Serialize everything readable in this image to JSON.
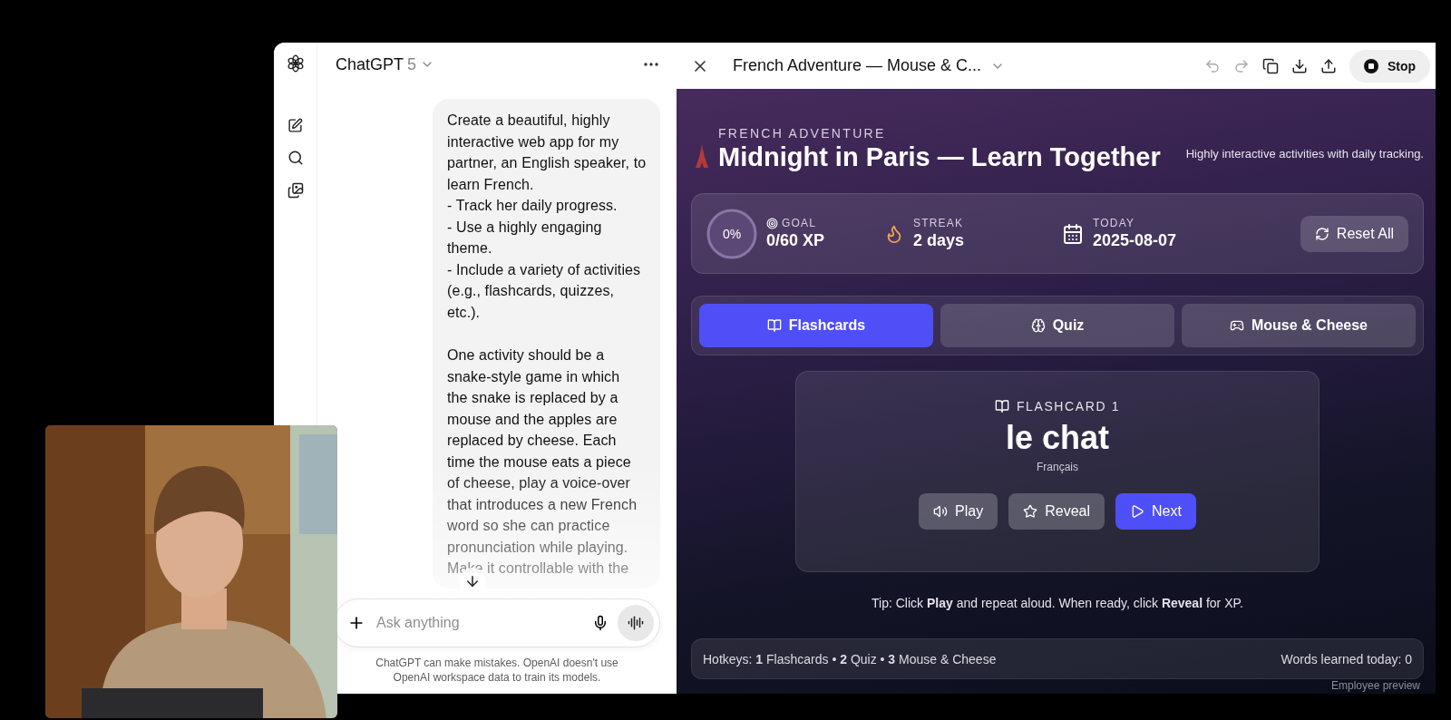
{
  "chat": {
    "model_name": "ChatGPT",
    "model_version": "5",
    "message": [
      "Create a beautiful, highly\ninteractive web app for my\npartner, an English speaker, to\nlearn French.\n- Track her daily progress.\n- Use a highly engaging\ntheme.\n- Include a variety of activities\n(e.g., flashcards, quizzes,\netc.).",
      "One activity should be a\nsnake-style game in which\nthe snake is replaced by a\nmouse and the apples are\nreplaced by cheese. Each\ntime the mouse eats a piece\nof cheese, play a voice-over\nthat introduces a new French\nword so she can practice\npronunciation while playing.\nMake it controllable with the"
    ],
    "input": {
      "placeholder": "Ask anything"
    },
    "disclaimer": "ChatGPT can make mistakes. OpenAI doesn't use OpenAI workspace data to train its models."
  },
  "canvas": {
    "title": "French Adventure — Mouse & C...",
    "stop_label": "Stop"
  },
  "app": {
    "eyebrow": "FRENCH ADVENTURE",
    "title": "Midnight in Paris — Learn Together",
    "tagline": "Highly interactive activities with daily tracking.",
    "stats": {
      "progress": {
        "label": "0%",
        "level": 0
      },
      "items": [
        {
          "kind": "goal",
          "label": "GOAL",
          "value": "0/60 XP"
        },
        {
          "kind": "streak",
          "label": "STREAK",
          "value": "2 days"
        },
        {
          "kind": "date",
          "label": "TODAY",
          "value": "2025-08-07"
        }
      ],
      "reset_label": "Reset All"
    },
    "tabs": [
      {
        "kind": "flashcards",
        "label": "Flashcards",
        "selected": true
      },
      {
        "kind": "quiz",
        "label": "Quiz",
        "selected": false
      },
      {
        "kind": "game",
        "label": "Mouse & Cheese",
        "selected": false
      }
    ],
    "card": {
      "heading": "FLASHCARD 1",
      "word": "le chat",
      "language": "Français",
      "buttons": [
        {
          "kind": "play",
          "label": "Play",
          "primary": false
        },
        {
          "kind": "reveal",
          "label": "Reveal",
          "primary": false
        },
        {
          "kind": "next",
          "label": "Next",
          "primary": true
        }
      ]
    },
    "tip": "Tip: Click **Play** and repeat aloud. When ready, click **Reveal** for XP.",
    "hotkeys": "Hotkeys: **1** Flashcards • **2** Quiz • **3** Mouse & Cheese",
    "words_learned": "Words learned today: 0",
    "preview_note": "Employee preview"
  }
}
